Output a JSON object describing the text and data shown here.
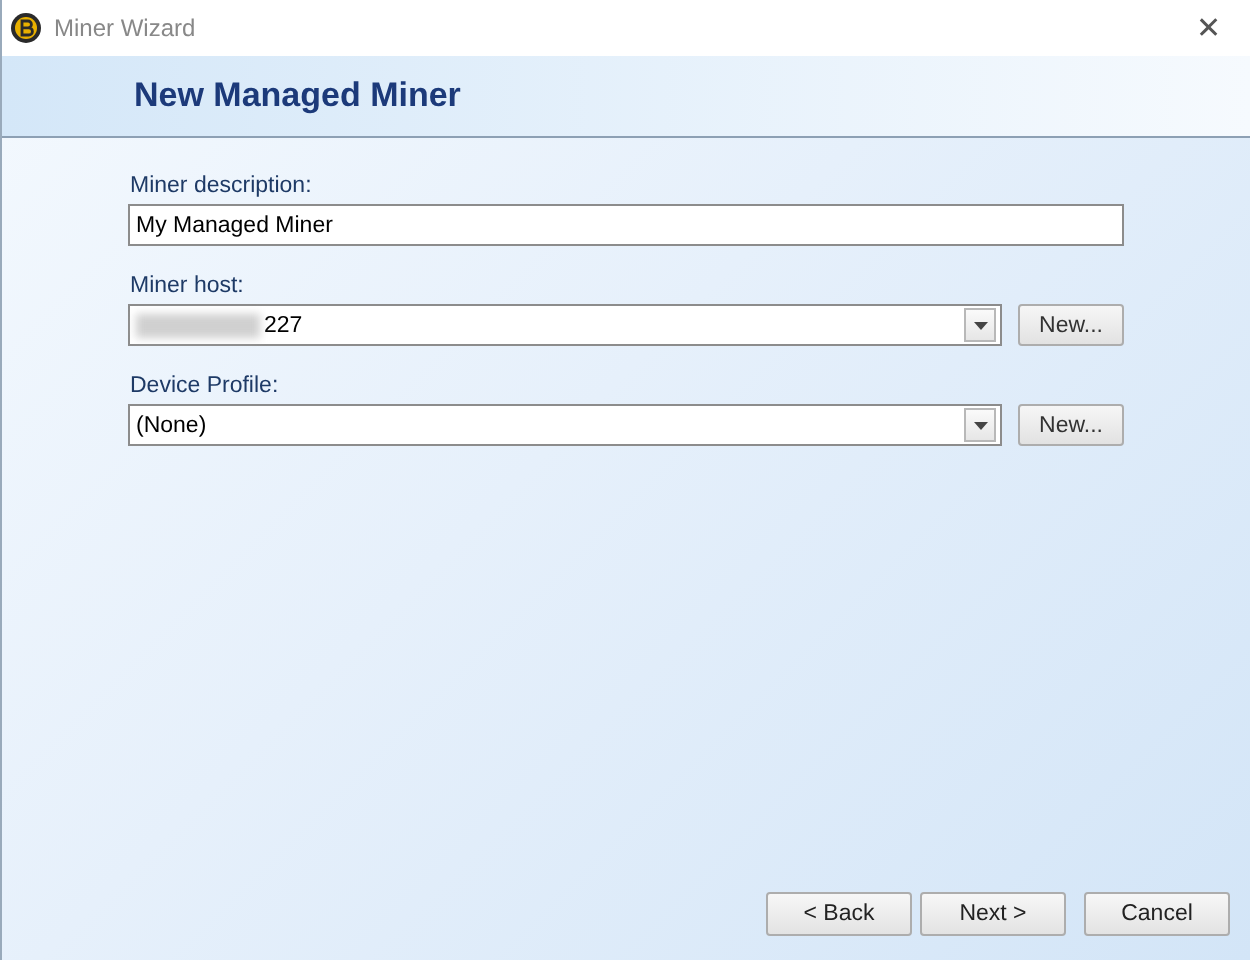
{
  "window": {
    "title": "Miner Wizard",
    "close": "✕"
  },
  "header": {
    "title": "New Managed Miner"
  },
  "miner_description": {
    "kind": "text",
    "label": "Miner description:",
    "value": "My Managed Miner"
  },
  "miner_host": {
    "kind": "combo",
    "label": "Miner host:",
    "value": "227",
    "redacted": true,
    "button": "New..."
  },
  "device_profile": {
    "kind": "combo",
    "label": "Device Profile:",
    "value": "(None)",
    "redacted": false,
    "button": "New..."
  },
  "buttons": [
    {
      "label": "< Back",
      "kind": "nav"
    },
    {
      "label": "Next >",
      "kind": "nav"
    },
    {
      "label": "Cancel",
      "kind": "cancel"
    }
  ]
}
